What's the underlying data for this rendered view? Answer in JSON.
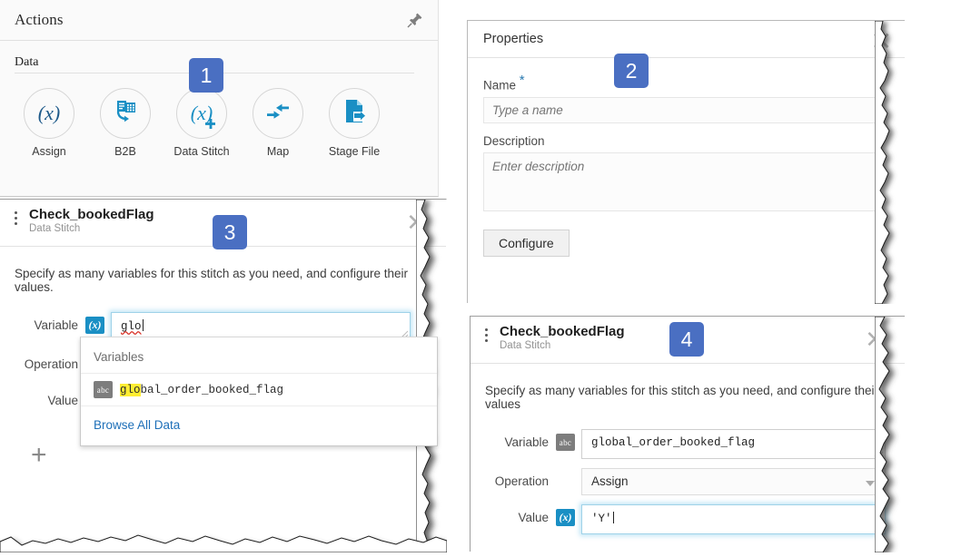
{
  "badges": {
    "one": "1",
    "two": "2",
    "three": "3",
    "four": "4",
    "color": "#4a6fc2"
  },
  "actions_panel": {
    "title": "Actions",
    "pin_icon": "pin-icon",
    "group_label": "Data",
    "items": [
      {
        "label": "Assign",
        "icon": "paren-x-icon",
        "color": "#1e5a8a"
      },
      {
        "label": "B2B",
        "icon": "b2b-document-icon",
        "color": "#1a8fc4"
      },
      {
        "label": "Data Stitch",
        "icon": "paren-x-plus-icon",
        "color": "#1a8fc4"
      },
      {
        "label": "Map",
        "icon": "map-arrows-icon",
        "color": "#1a8fc4"
      },
      {
        "label": "Stage File",
        "icon": "stage-file-icon",
        "color": "#1a8fc4"
      }
    ]
  },
  "properties_panel": {
    "title": "Properties",
    "close_icon": "close-icon",
    "name_label": "Name",
    "name_required_marker": "*",
    "name_placeholder": "Type a name",
    "name_value": "",
    "description_label": "Description",
    "description_placeholder": "Enter description",
    "description_value": "",
    "configure_button": "Configure"
  },
  "stitch_panel_3": {
    "title": "Check_bookedFlag",
    "subtitle": "Data Stitch",
    "kebab_icon": "kebab-menu-icon",
    "close_icon": "close-icon",
    "description": "Specify as many variables for this stitch as you need, and configure their values.",
    "variable_label": "Variable",
    "variable_type_icon": "expression-x-icon",
    "variable_value": "glo",
    "operation_label": "Operation",
    "value_label": "Value",
    "add_button": "+"
  },
  "autocomplete": {
    "heading": "Variables",
    "items": [
      {
        "icon": "abc-string-icon",
        "match": "glo",
        "rest": "bal_order_booked_flag"
      }
    ],
    "footer_link": "Browse All Data",
    "highlight_color": "#ffee33"
  },
  "stitch_panel_4": {
    "title": "Check_bookedFlag",
    "subtitle": "Data Stitch",
    "kebab_icon": "kebab-menu-icon",
    "close_icon": "close-icon",
    "description": "Specify as many variables for this stitch as you need, and configure their values",
    "variable_label": "Variable",
    "variable_type_icon": "abc-string-icon",
    "variable_value": "global_order_booked_flag",
    "operation_label": "Operation",
    "operation_value": "Assign",
    "value_label": "Value",
    "value_type_icon": "expression-x-icon",
    "value_value": "'Y'"
  }
}
